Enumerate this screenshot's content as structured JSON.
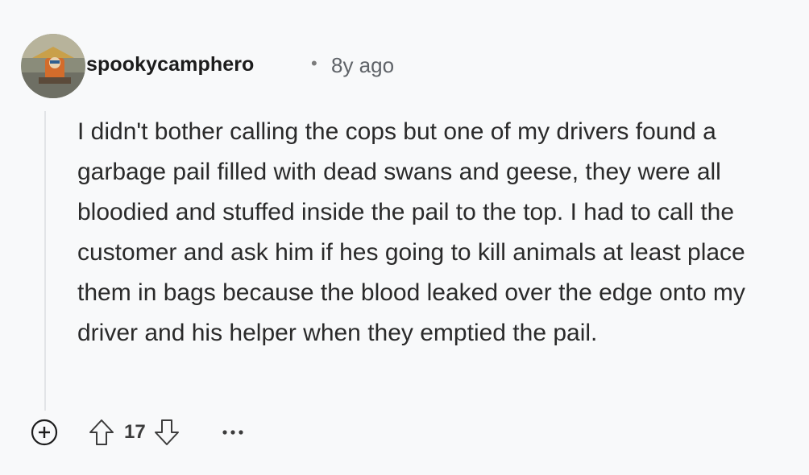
{
  "comment": {
    "author": "spookycamphero",
    "separator": "•",
    "timestamp": "8y ago",
    "avatar_icon": "avatar-icon",
    "body": "I didn't bother calling the cops but one of my drivers found a garbage pail filled with dead swans and geese, they were all bloodied and stuffed inside the pail to the top. I had to call the customer and ask him if hes going to kill animals at least place them in bags because the blood leaked over the edge onto my driver and his helper when they emptied the pail.",
    "score": "17"
  },
  "actions": {
    "expand_icon": "plus-circle-icon",
    "upvote_icon": "upvote-arrow-icon",
    "downvote_icon": "downvote-arrow-icon",
    "more_icon": "more-options-icon"
  },
  "colors": {
    "background": "#f8f9fa",
    "text": "#2a2a2a",
    "muted": "#5f6368",
    "thread_line": "#e2e4e7"
  }
}
